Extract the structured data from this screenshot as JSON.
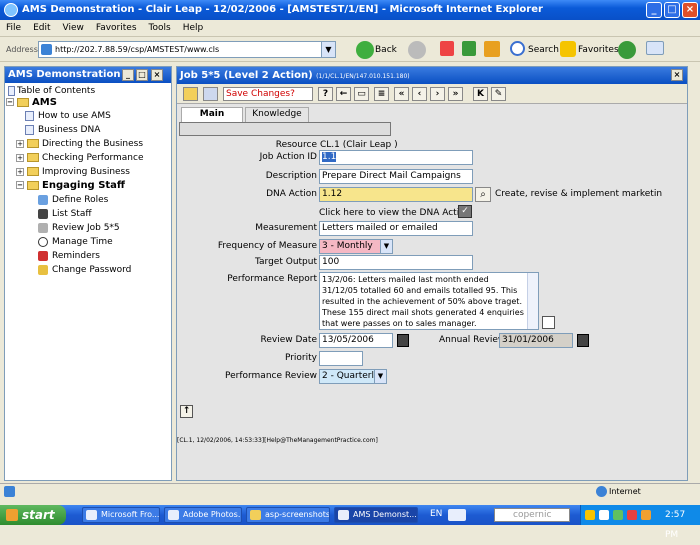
{
  "window": {
    "title": "AMS Demonstration - Clair Leap - 12/02/2006 - [AMSTEST/1/EN] - Microsoft Internet Explorer"
  },
  "menu": [
    "File",
    "Edit",
    "View",
    "Favorites",
    "Tools",
    "Help"
  ],
  "address": {
    "label": "Address",
    "url": "http://202.7.88.59/csp/AMSTEST/www.cls"
  },
  "ie_toolbar": {
    "back": "Back",
    "search": "Search",
    "favorites": "Favorites"
  },
  "left": {
    "title": "AMS Demonstration",
    "toc": "Table of Contents",
    "root": "AMS",
    "items": [
      {
        "label": "How to use AMS"
      },
      {
        "label": "Business DNA"
      },
      {
        "label": "Directing the Business"
      },
      {
        "label": "Checking Performance"
      },
      {
        "label": "Improving Business"
      },
      {
        "label": "Engaging Staff"
      },
      {
        "label": "Define Roles"
      },
      {
        "label": "List Staff"
      },
      {
        "label": "Review Job 5*5"
      },
      {
        "label": "Manage Time"
      },
      {
        "label": "Reminders"
      },
      {
        "label": "Change Password"
      }
    ]
  },
  "main": {
    "title": "Job 5*5 (Level 2 Action)",
    "path": "(1/1/CL.1/EN/147.010.151.180)",
    "save_changes": "Save Changes?",
    "tabs": [
      "Main",
      "Knowledge"
    ],
    "form": {
      "resource_label": "Resource",
      "resource_value": "CL.1  (Clair Leap )",
      "job_action_id_label": "Job Action ID",
      "job_action_id_value": "1.1",
      "description_label": "Description",
      "description_value": "Prepare Direct Mail Campaigns",
      "dna_action_label": "DNA Action",
      "dna_action_value": "1.12",
      "dna_action_desc": "Create, revise & implement marketin",
      "view_dna_label": "Click here to view the DNA Action",
      "measurement_label": "Measurement",
      "measurement_value": "Letters mailed or emailed",
      "frequency_label": "Frequency of Measure",
      "frequency_value": "3 - Monthly",
      "target_label": "Target Output",
      "target_value": "100",
      "perf_report_label": "Performance Report",
      "perf_report_value": "13/2/06: Letters mailed last month ended 31/12/05 totalled 60 and emails totalled 95. This resulted in the achievement of 50% above traget. These 155 direct mail shots generated 4 enquiries that were passes on to sales manager.",
      "review_date_label": "Review Date",
      "review_date_value": "13/05/2006",
      "annual_review_label": "Annual Review",
      "annual_review_value": "31/01/2006",
      "priority_label": "Priority",
      "priority_value": "",
      "perf_review_label": "Performance Review",
      "perf_review_value": "2 - Quarterly"
    },
    "footer": "[CL.1, 12/02/2006, 14:53:33][Help@TheManagementPractice.com]"
  },
  "status": {
    "zone": "Internet"
  },
  "taskbar": {
    "start": "start",
    "tasks": [
      "Microsoft Fro...",
      "Adobe Photos...",
      "asp-screenshots",
      "AMS Demonst..."
    ],
    "lang": "EN",
    "search": "copernic",
    "clock": "2:57 PM"
  },
  "colors": {
    "titlebar": "#0a5ad8",
    "save_text": "#d00000",
    "dna_highlight": "#f7e58c",
    "freq_highlight": "#f5b8c4",
    "review_highlight": "#cfe8f8"
  }
}
